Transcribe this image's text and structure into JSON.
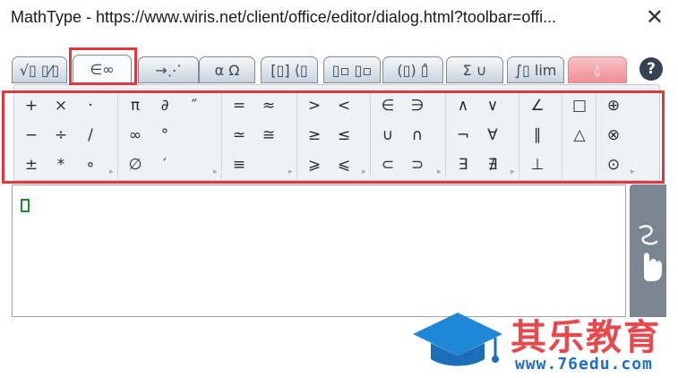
{
  "window": {
    "title": "MathType - https://www.wiris.net/client/office/editor/dialog.html?toolbar=offi...",
    "close_glyph": "✕"
  },
  "tabs": [
    {
      "label": "√▯ ▯⁄▯",
      "name": "tab-general"
    },
    {
      "label": "∈∞",
      "name": "tab-symbols"
    },
    {
      "label": "→⋰",
      "name": "tab-arrows"
    },
    {
      "label": "α Ω",
      "name": "tab-greek"
    },
    {
      "label": "[▯] ⟨▯",
      "name": "tab-matrices"
    },
    {
      "label": "▯▫ ▯▫",
      "name": "tab-scripts"
    },
    {
      "label": "(▯) ▯̂",
      "name": "tab-decorations"
    },
    {
      "label": "Σ ∪",
      "name": "tab-big-operators"
    },
    {
      "label": "∫▯ lim",
      "name": "tab-calculus"
    },
    {
      "label": "⍙",
      "name": "tab-contextual"
    }
  ],
  "help_label": "?",
  "palette": {
    "groups": [
      [
        "+",
        "×",
        "·",
        "−",
        "÷",
        "/",
        "±",
        "*",
        "∘"
      ],
      [
        "π",
        "∂",
        "″",
        "∞",
        "°",
        "",
        "∅",
        "′",
        ""
      ],
      [
        "=",
        "≈",
        "≃",
        "≅",
        "≡",
        ""
      ],
      [
        ">",
        "<",
        "≥",
        "≤",
        "⩾",
        "⩽"
      ],
      [
        "∈",
        "∋",
        "∪",
        "∩",
        "⊂",
        "⊃"
      ],
      [
        "∧",
        "∨",
        "¬",
        "∀",
        "∃",
        "∄"
      ],
      [
        "∠",
        "∥",
        "⊥"
      ],
      [
        "□",
        "△",
        ""
      ],
      [
        "⊕",
        "⊗",
        "⊙"
      ]
    ]
  },
  "editor": {
    "placeholder": ""
  },
  "watermark": {
    "title": "其乐教育",
    "url": "www.76edu.com"
  }
}
